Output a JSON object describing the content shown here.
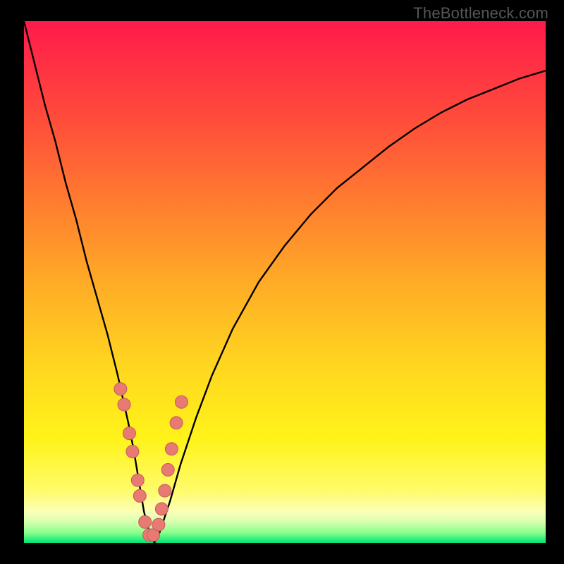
{
  "watermark": "TheBottleneck.com",
  "colors": {
    "curve": "#000000",
    "marker_fill": "#e77b74",
    "marker_stroke": "#c85a55"
  },
  "chart_data": {
    "type": "line",
    "title": "",
    "xlabel": "",
    "ylabel": "",
    "xlim": [
      0,
      100
    ],
    "ylim": [
      0,
      100
    ],
    "x": [
      0,
      2,
      4,
      6,
      8,
      10,
      12,
      14,
      16,
      18,
      20,
      21,
      22,
      23,
      24,
      25,
      26,
      28,
      30,
      33,
      36,
      40,
      45,
      50,
      55,
      60,
      65,
      70,
      75,
      80,
      85,
      90,
      95,
      100
    ],
    "values": [
      100,
      92,
      84,
      77,
      69,
      62,
      54,
      47,
      40,
      32,
      23,
      18,
      12,
      6,
      2,
      0,
      2,
      8,
      15,
      24,
      32,
      41,
      50,
      57,
      63,
      68,
      72,
      76,
      79.5,
      82.5,
      85,
      87,
      89,
      90.5
    ],
    "markers": {
      "x": [
        18.5,
        19.2,
        20.2,
        20.8,
        21.8,
        22.2,
        23.2,
        24.0,
        24.8,
        25.8,
        26.4,
        27.0,
        27.6,
        28.3,
        29.2,
        30.2
      ],
      "y": [
        29.5,
        26.5,
        21.0,
        17.5,
        12.0,
        9.0,
        4.0,
        1.5,
        1.5,
        3.5,
        6.5,
        10.0,
        14.0,
        18.0,
        23.0,
        27.0
      ]
    }
  }
}
